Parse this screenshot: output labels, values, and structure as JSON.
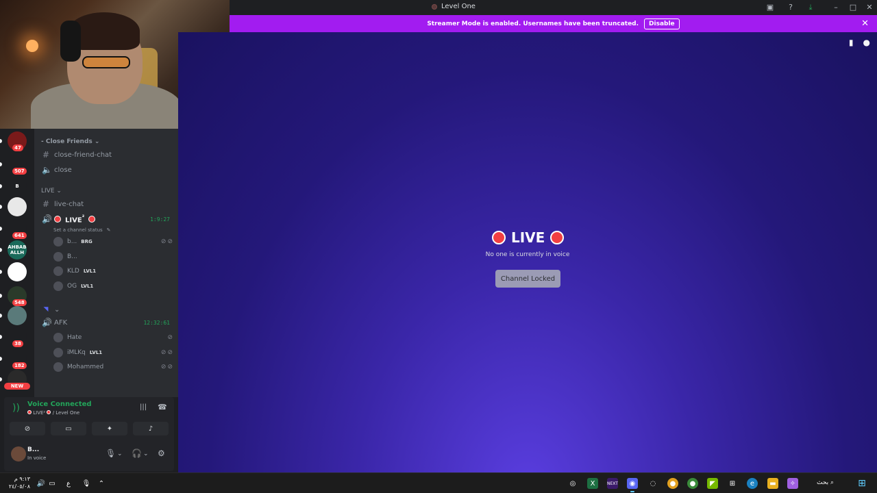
{
  "window": {
    "title": "Level One"
  },
  "banner": {
    "message": "Streamer Mode is enabled. Usernames have been truncated.",
    "button": "Disable"
  },
  "servers": [
    {
      "label": "",
      "badge": "47",
      "color": "#7a1a1a"
    },
    {
      "label": "",
      "badge": "507",
      "color": "#1e1f22"
    },
    {
      "label": "B",
      "badge": "",
      "color": "#1e1f22"
    },
    {
      "label": "",
      "badge": "",
      "color": "#e8e8e8"
    },
    {
      "label": "",
      "badge": "641",
      "color": "#1e1f22"
    },
    {
      "label": "AHBAB ALLH",
      "badge": "",
      "color": "#1a6a5a"
    },
    {
      "label": "",
      "badge": "",
      "color": "#ffffff"
    },
    {
      "label": "",
      "badge": "548",
      "color": "#2a3a2a"
    },
    {
      "label": "",
      "badge": "",
      "color": "#5a7a7a"
    },
    {
      "label": "",
      "badge": "38",
      "color": "#1e1f22"
    },
    {
      "label": "",
      "badge": "182",
      "color": "#1e1f22"
    },
    {
      "label": "",
      "badge": "NEW",
      "color": "#2a2a2a"
    }
  ],
  "channels": {
    "cat_close": "Close Friends",
    "close_friend_chat": "close-friend-chat",
    "close": "close",
    "cat_live": "LIVE",
    "live_chat": "live-chat",
    "live_voice": "LIVE",
    "live_voice_sup": "²",
    "live_timer": "1:9:27",
    "set_status": "Set a channel status",
    "members_live": [
      {
        "name": "b...",
        "tag": "BRG"
      },
      {
        "name": "B...",
        "tag": ""
      },
      {
        "name": "KLD",
        "tag": "LVL1"
      },
      {
        "name": "OG",
        "tag": "LVL1"
      }
    ],
    "afk": "AFK",
    "afk_timer": "12:32:61",
    "members_afk": [
      {
        "name": "Hate",
        "tag": ""
      },
      {
        "name": "iMLKq",
        "tag": "LVL1"
      },
      {
        "name": "Mohammed",
        "tag": ""
      }
    ]
  },
  "voice": {
    "status": "Voice Connected",
    "location": "LIVE²",
    "server": "/ Level One"
  },
  "user": {
    "name": "B...",
    "status": "In voice"
  },
  "stage": {
    "title": "LIVE",
    "empty_text": "No one is currently in voice",
    "locked_button": "Channel Locked"
  },
  "taskbar": {
    "time": "٩:١٣ م",
    "date": "٢٤/٠٥/٠٨",
    "lang": "ع",
    "search": "بحث"
  }
}
